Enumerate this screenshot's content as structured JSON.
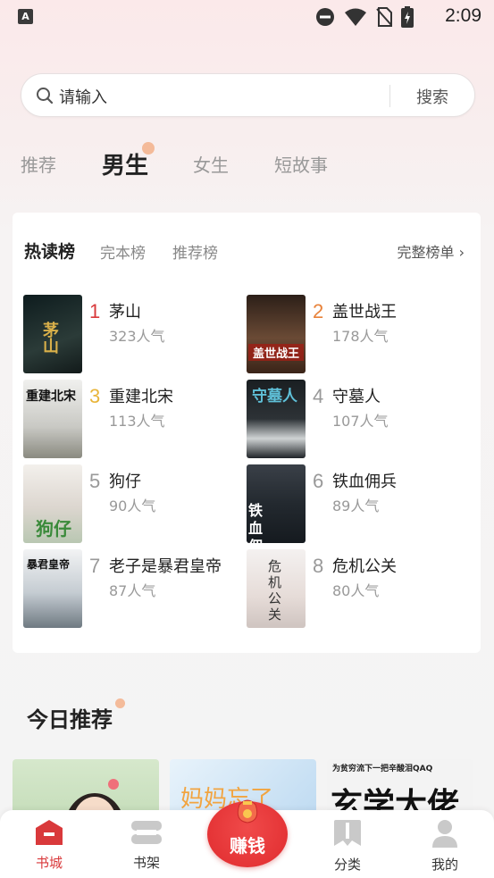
{
  "status_bar": {
    "app_badge": "A",
    "time": "2:09"
  },
  "search": {
    "placeholder": "请输入",
    "button_label": "搜索"
  },
  "category_tabs": [
    {
      "label": "推荐",
      "active": false
    },
    {
      "label": "男生",
      "active": true
    },
    {
      "label": "女生",
      "active": false
    },
    {
      "label": "短故事",
      "active": false
    }
  ],
  "ranking": {
    "tabs": [
      {
        "label": "热读榜",
        "active": true
      },
      {
        "label": "完本榜",
        "active": false
      },
      {
        "label": "推荐榜",
        "active": false
      }
    ],
    "full_list_label": "完整榜单 ›",
    "books": [
      {
        "rank": "1",
        "title": "茅山",
        "popularity": "323人气",
        "rank_color": "#d9393b"
      },
      {
        "rank": "2",
        "title": "盖世战王",
        "popularity": "178人气",
        "rank_color": "#e8823a"
      },
      {
        "rank": "3",
        "title": "重建北宋",
        "popularity": "113人气",
        "rank_color": "#e8b53a"
      },
      {
        "rank": "4",
        "title": "守墓人",
        "popularity": "107人气",
        "rank_color": "#999999"
      },
      {
        "rank": "5",
        "title": "狗仔",
        "popularity": "90人气",
        "rank_color": "#999999"
      },
      {
        "rank": "6",
        "title": "铁血佣兵",
        "popularity": "89人气",
        "rank_color": "#999999"
      },
      {
        "rank": "7",
        "title": "老子是暴君皇帝",
        "popularity": "87人气",
        "rank_color": "#999999"
      },
      {
        "rank": "8",
        "title": "危机公关",
        "popularity": "80人气",
        "rank_color": "#999999"
      }
    ],
    "covers": [
      {
        "text": "茅山",
        "bg": "#1d2a2c",
        "fg": "#d9b04a"
      },
      {
        "text": "盖世战王",
        "bg": "#3a2a22",
        "fg": "#ffffff"
      },
      {
        "text": "重建北宋",
        "bg": "#e8e8e6",
        "fg": "#222222"
      },
      {
        "text": "守墓人",
        "bg": "#1e2326",
        "fg": "#5fc0d8"
      },
      {
        "text": "狗仔",
        "bg": "#dfe6dc",
        "fg": "#3a8a3a"
      },
      {
        "text": "铁血佣兵",
        "bg": "#27303a",
        "fg": "#ffffff"
      },
      {
        "text": "暴君皇帝",
        "bg": "#e6e8ea",
        "fg": "#222222"
      },
      {
        "text": "危机公关",
        "bg": "#f2eeee",
        "fg": "#333333"
      }
    ]
  },
  "today": {
    "title": "今日推荐",
    "cards": [
      {
        "text": "",
        "bg": "#cfe3c4"
      },
      {
        "text": "妈妈忘了",
        "bg": "#cfe6f6"
      },
      {
        "text": "为贫穷流下一把辛酸泪QAQ",
        "bg": "#f2f2f2"
      }
    ],
    "card3_big": "玄学大佬"
  },
  "bottom_nav": [
    {
      "label": "书城",
      "icon": "bookstore-icon",
      "active": true
    },
    {
      "label": "书架",
      "icon": "bookshelf-icon",
      "active": false
    },
    {
      "label": "赚钱",
      "icon": "red-envelope-icon",
      "active": false
    },
    {
      "label": "分类",
      "icon": "category-icon",
      "active": false
    },
    {
      "label": "我的",
      "icon": "profile-icon",
      "active": false
    }
  ],
  "colors": {
    "accent": "#d9393b",
    "earn_button": "#e43a3c"
  }
}
